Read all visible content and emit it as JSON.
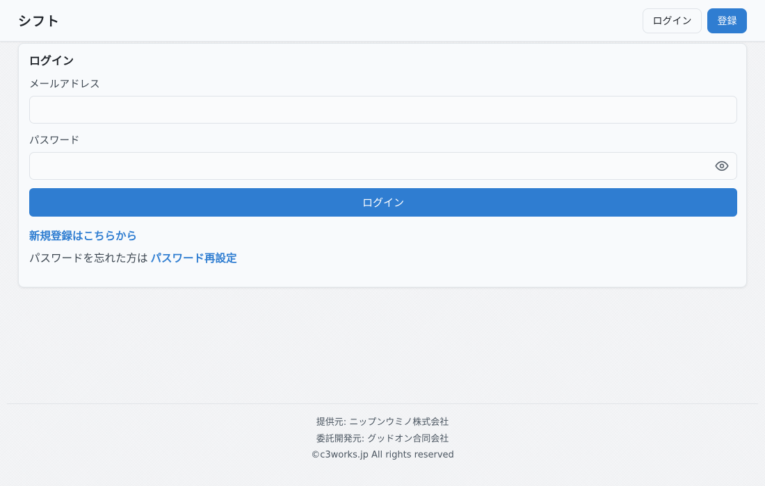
{
  "header": {
    "brand": "シフト",
    "login_label": "ログイン",
    "register_label": "登録"
  },
  "login_form": {
    "title": "ログイン",
    "email_label": "メールアドレス",
    "email_value": "",
    "password_label": "パスワード",
    "password_value": "",
    "submit_label": "ログイン",
    "signup_link": "新規登録はこちらから",
    "forgot_text": "パスワードを忘れた方は",
    "reset_link": "パスワード再設定"
  },
  "footer": {
    "provider": "提供元: ニップンウミノ株式会社",
    "developer": "委託開発元: グッドオン合同会社",
    "copyright": "©c3works.jp All rights reserved"
  },
  "icons": {
    "password_toggle": "eye-icon"
  },
  "colors": {
    "accent": "#2f7dd1",
    "background": "#f4f5f7",
    "surface": "#f8fafc"
  }
}
